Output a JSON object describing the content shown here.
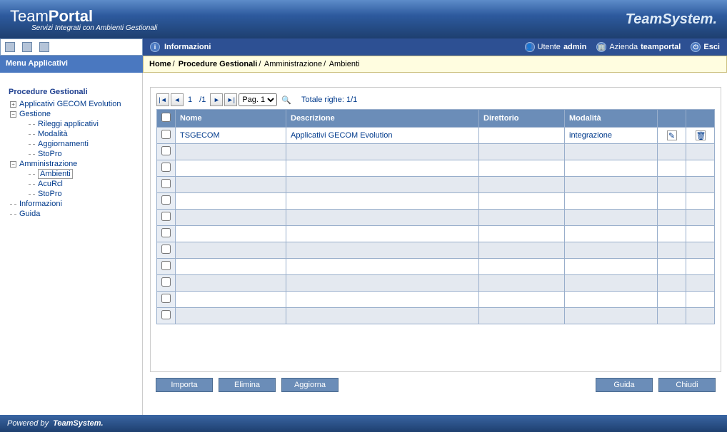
{
  "brand": {
    "left_a": "Team",
    "left_b": "Portal",
    "sub": "Servizi Integrati con Ambienti Gestionali",
    "right": "TeamSystem."
  },
  "topbar": {
    "info": "Informazioni",
    "user_label": "Utente",
    "user": "admin",
    "company_label": "Azienda",
    "company": "teamportal",
    "exit": "Esci"
  },
  "menubar": {
    "title": "Menu Applicativi"
  },
  "breadcrumb": {
    "p0": "Home",
    "p1": "Procedure Gestionali",
    "p2": "Amministrazione",
    "p3": "Ambienti"
  },
  "sidebar": {
    "head": "Procedure Gestionali",
    "items": [
      {
        "label": "Applicativi GECOM Evolution",
        "icon": "plus",
        "depth": 1
      },
      {
        "label": "Gestione",
        "icon": "minus",
        "depth": 1
      },
      {
        "label": "Rileggi applicativi",
        "icon": "leaf",
        "depth": 2
      },
      {
        "label": "Modalità",
        "icon": "leaf",
        "depth": 2
      },
      {
        "label": "Aggiornamenti",
        "icon": "leaf",
        "depth": 2
      },
      {
        "label": "StoPro",
        "icon": "leaf",
        "depth": 2
      },
      {
        "label": "Amministrazione",
        "icon": "minus",
        "depth": 1
      },
      {
        "label": "Ambienti",
        "icon": "leaf",
        "depth": 2,
        "current": true
      },
      {
        "label": "AcuRcl",
        "icon": "leaf",
        "depth": 2
      },
      {
        "label": "StoPro",
        "icon": "leaf",
        "depth": 2
      },
      {
        "label": "Informazioni",
        "icon": "leaf",
        "depth": 1
      },
      {
        "label": "Guida",
        "icon": "leaf",
        "depth": 1
      }
    ]
  },
  "pager": {
    "page": "1",
    "pages": "1",
    "select": "Pag. 1",
    "total": "Totale righe: 1/1"
  },
  "table": {
    "headers": {
      "nome": "Nome",
      "descrizione": "Descrizione",
      "direttorio": "Direttorio",
      "modalita": "Modalità"
    },
    "rows": [
      {
        "nome": "TSGECOM",
        "descrizione": "Applicativi GECOM Evolution",
        "direttorio": "",
        "modalita": "integrazione"
      }
    ],
    "empty_rows": 11
  },
  "buttons": {
    "importa": "Importa",
    "elimina": "Elimina",
    "aggiorna": "Aggiorna",
    "guida": "Guida",
    "chiudi": "Chiudi"
  },
  "footer": {
    "powered": "Powered by",
    "brand": "TeamSystem."
  }
}
